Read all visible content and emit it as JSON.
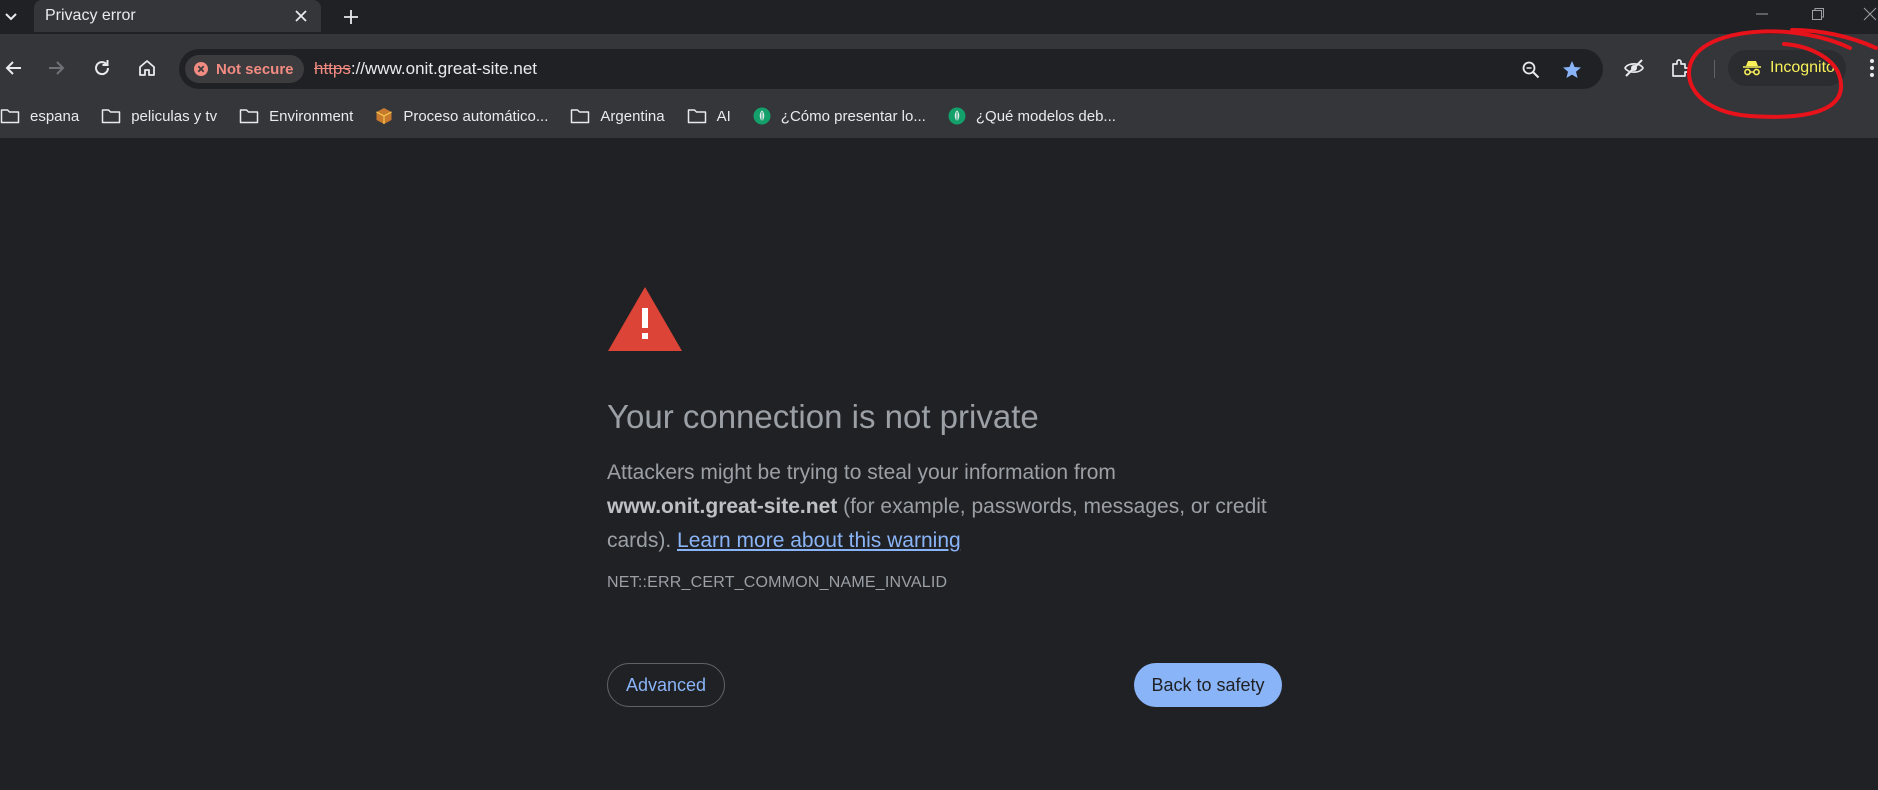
{
  "tab": {
    "title": "Privacy error"
  },
  "omnibox": {
    "security_chip": "Not secure",
    "url_scheme": "https",
    "url_rest": "://www.onit.great-site.net"
  },
  "profile": {
    "label": "Incognito"
  },
  "bookmarks": [
    {
      "label": "espana",
      "icon": "folder-icon"
    },
    {
      "label": "peliculas y tv",
      "icon": "folder-icon"
    },
    {
      "label": "Environment",
      "icon": "folder-icon"
    },
    {
      "label": "Proceso automático...",
      "icon": "package-icon"
    },
    {
      "label": "Argentina",
      "icon": "folder-icon"
    },
    {
      "label": "AI",
      "icon": "folder-icon"
    },
    {
      "label": "¿Cómo presentar lo...",
      "icon": "leaf-icon"
    },
    {
      "label": "¿Qué modelos deb...",
      "icon": "leaf-icon"
    }
  ],
  "error_page": {
    "heading": "Your connection is not private",
    "body_intro": "Attackers might be trying to steal your information from",
    "domain": "www.onit.great-site.net",
    "body_examples": " (for example, passwords, messages, or credit cards). ",
    "learn_more": "Learn more about this warning",
    "error_code": "NET::ERR_CERT_COMMON_NAME_INVALID",
    "advanced_label": "Advanced",
    "back_label": "Back to safety"
  },
  "colors": {
    "background": "#202124",
    "toolbar": "#35363a",
    "warning_red": "#db4437",
    "link_blue": "#8ab4f8",
    "not_secure_red": "#f28b82",
    "incognito_yellow": "#f9f15a",
    "annotation_red": "#e8121b"
  }
}
